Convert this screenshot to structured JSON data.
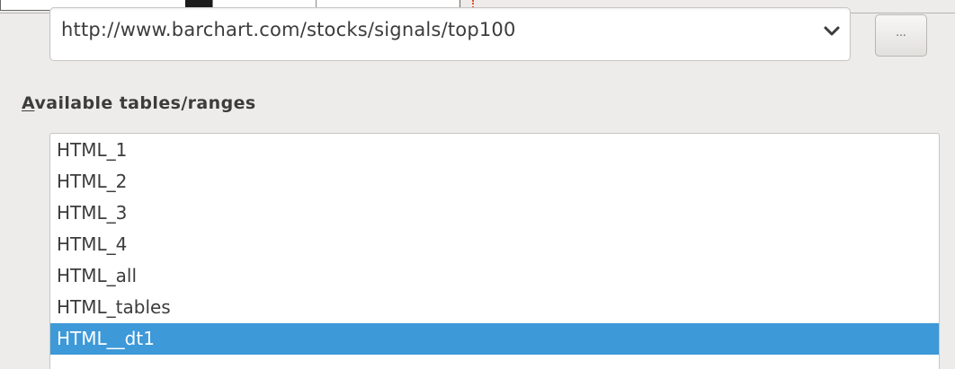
{
  "url_combo": {
    "value": "http://www.barchart.com/stocks/signals/top100",
    "arrow_icon": "chevron-down-icon"
  },
  "browse_button": {
    "label": "..."
  },
  "tables_section": {
    "label_mnemonic": "A",
    "label_rest": "vailable tables/ranges"
  },
  "tables_list": {
    "items": [
      {
        "label": "HTML_1",
        "selected": false
      },
      {
        "label": "HTML_2",
        "selected": false
      },
      {
        "label": "HTML_3",
        "selected": false
      },
      {
        "label": "HTML_4",
        "selected": false
      },
      {
        "label": "HTML_all",
        "selected": false
      },
      {
        "label": "HTML_tables",
        "selected": false
      },
      {
        "label": "HTML__dt1",
        "selected": true
      }
    ]
  },
  "colors": {
    "background": "#edeceb",
    "selection": "#3d99d8",
    "selection_text": "#ffffff",
    "text": "#3c3c3c"
  }
}
